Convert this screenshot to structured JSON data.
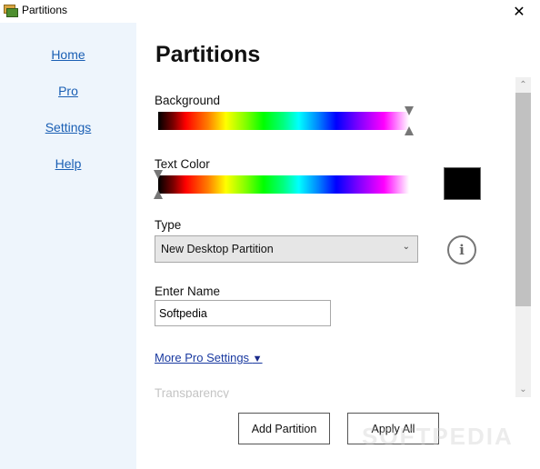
{
  "window": {
    "title": "Partitions",
    "icon": "app-partitions-icon",
    "close_glyph": "✕"
  },
  "sidebar": {
    "items": [
      {
        "label": "Home"
      },
      {
        "label": "Pro"
      },
      {
        "label": "Settings"
      },
      {
        "label": "Help"
      }
    ]
  },
  "main": {
    "title": "Partitions",
    "background": {
      "label": "Background",
      "slider_position_fraction": 1.0
    },
    "text_color": {
      "label": "Text Color",
      "slider_position_fraction": 0.0,
      "swatch_color": "#000000"
    },
    "type": {
      "label": "Type",
      "selected": "New Desktop Partition",
      "chevron": "⌄",
      "info_glyph": "i"
    },
    "name": {
      "label": "Enter Name",
      "value": "Softpedia"
    },
    "more_pro_settings": {
      "label": "More Pro Settings",
      "arrow": "▼"
    },
    "transparency_label": "Transparency",
    "scrollbar": {
      "up_glyph": "⌃",
      "down_glyph": "⌄",
      "thumb_top_fraction": 0.0,
      "thumb_size_fraction": 0.74
    },
    "buttons": {
      "add_partition": "Add Partition",
      "apply_all": "Apply All"
    }
  },
  "watermark": "SOFTPEDIA"
}
